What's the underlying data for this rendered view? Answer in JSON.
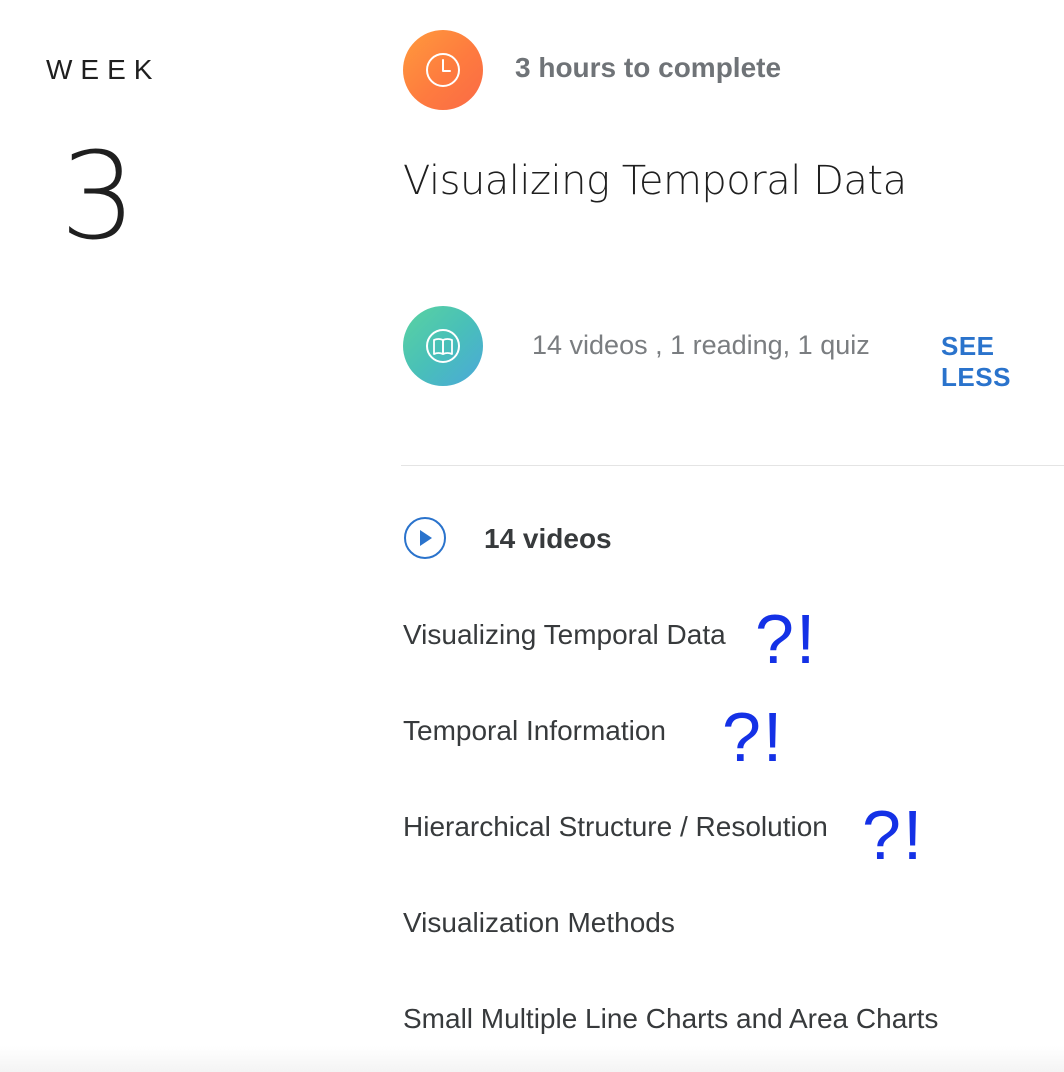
{
  "week": {
    "label": "WEEK",
    "number": "3"
  },
  "module": {
    "duration": "3 hours to complete",
    "title": "Visualizing Temporal Data",
    "summary": "14 videos , 1 reading, 1 quiz",
    "toggle_label": "SEE LESS"
  },
  "videos": {
    "heading": "14 videos",
    "items": [
      "Visualizing Temporal Data",
      "Temporal Information",
      "Hierarchical Structure / Resolution",
      "Visualization Methods",
      "Small Multiple Line Charts and Area Charts"
    ]
  },
  "annotations": {
    "marker": "?!"
  },
  "icons": {
    "duration": "clock-icon",
    "summary": "book-icon",
    "videos": "play-icon"
  },
  "colors": {
    "accent": "#2a73cc",
    "marker": "#1431e6",
    "clock_gradient": [
      "#ff9a3c",
      "#fa6a46"
    ],
    "book_gradient": [
      "#5ad3a0",
      "#4aa8da"
    ]
  }
}
